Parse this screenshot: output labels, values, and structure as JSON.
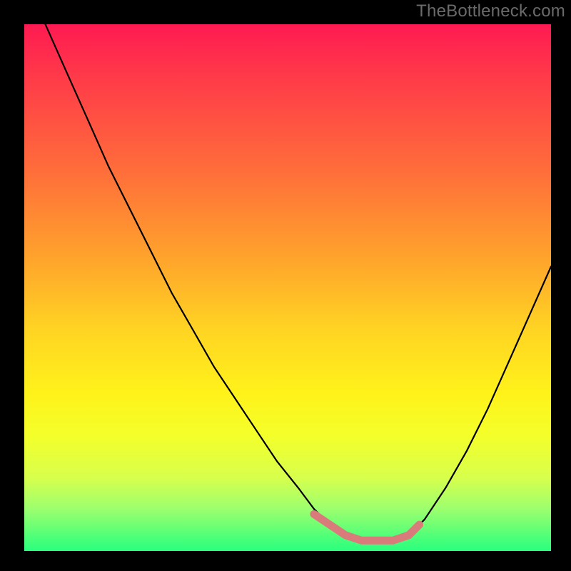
{
  "watermark": "TheBottleneck.com",
  "colors": {
    "curve": "#000000",
    "marker": "#d97b7b",
    "gradient_stops": [
      "#ff1a52",
      "#ff3a49",
      "#ff6e3a",
      "#ffa22c",
      "#ffd423",
      "#fff21a",
      "#f4ff2a",
      "#d8ff4c",
      "#9cff6e",
      "#28ff7e"
    ]
  },
  "chart_data": {
    "type": "line",
    "title": "",
    "xlabel": "",
    "ylabel": "",
    "xlim": [
      0,
      100
    ],
    "ylim": [
      0,
      100
    ],
    "series": [
      {
        "name": "bottleneck-curve",
        "x": [
          0,
          4,
          8,
          12,
          16,
          20,
          24,
          28,
          32,
          36,
          40,
          44,
          48,
          52,
          55,
          58,
          61,
          64,
          67,
          70,
          73,
          76,
          80,
          84,
          88,
          92,
          96,
          100
        ],
        "y": [
          110,
          100,
          91,
          82,
          73,
          65,
          57,
          49,
          42,
          35,
          29,
          23,
          17,
          12,
          8,
          5,
          3,
          2,
          2,
          2,
          3,
          6,
          12,
          19,
          27,
          36,
          45,
          54
        ]
      }
    ],
    "markers": [
      {
        "name": "highlight-region",
        "x": [
          55,
          58,
          61,
          64,
          67,
          70,
          73,
          75
        ],
        "y": [
          7,
          5,
          3,
          2,
          2,
          2,
          3,
          5
        ]
      }
    ],
    "background_gradient": {
      "direction": "vertical",
      "meaning": "mismatch severity (top=high, bottom=low)",
      "stops": [
        {
          "pos": 0.0,
          "color": "#ff1a52"
        },
        {
          "pos": 0.1,
          "color": "#ff3a49"
        },
        {
          "pos": 0.28,
          "color": "#ff6e3a"
        },
        {
          "pos": 0.44,
          "color": "#ffa22c"
        },
        {
          "pos": 0.58,
          "color": "#ffd423"
        },
        {
          "pos": 0.7,
          "color": "#fff21a"
        },
        {
          "pos": 0.78,
          "color": "#f4ff2a"
        },
        {
          "pos": 0.86,
          "color": "#d8ff4c"
        },
        {
          "pos": 0.92,
          "color": "#9cff6e"
        },
        {
          "pos": 1.0,
          "color": "#28ff7e"
        }
      ]
    }
  }
}
